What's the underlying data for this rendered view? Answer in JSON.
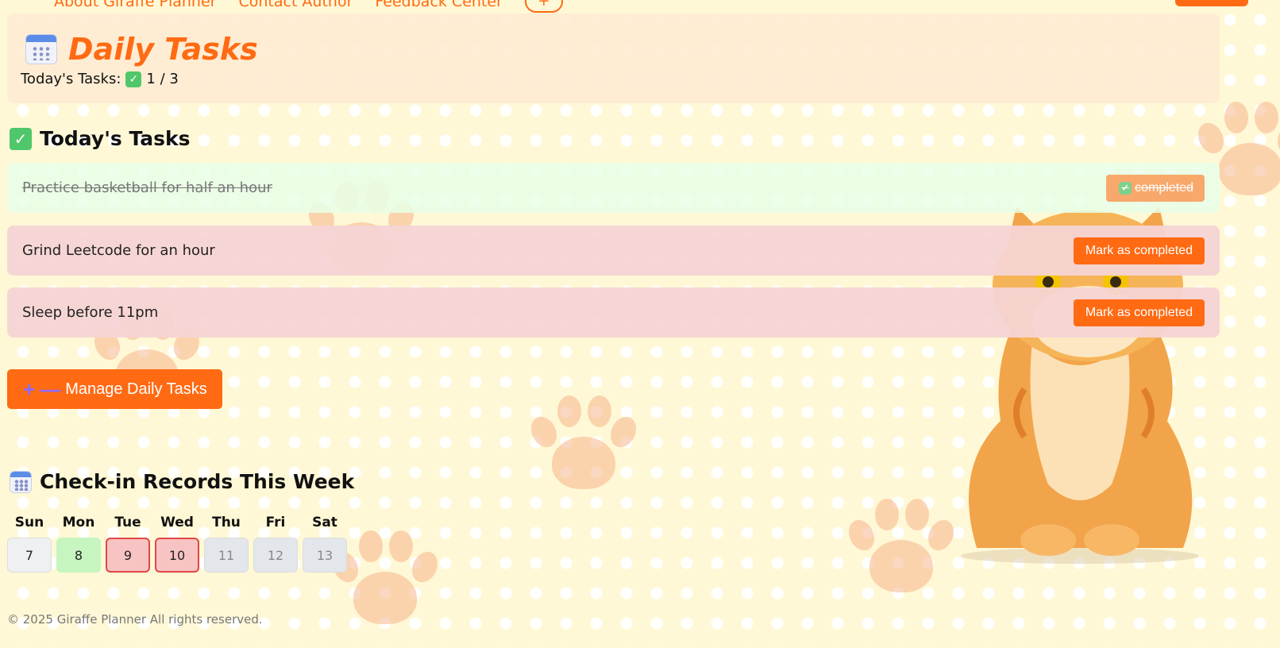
{
  "nav": {
    "links": [
      "About Giraffe Planner",
      "Contact Author",
      "Feedback Center"
    ],
    "plus_label": "+"
  },
  "header": {
    "icon": "calendar-icon",
    "title": "Daily Tasks",
    "progress_label": "Today's Tasks:",
    "progress_value": "1 / 3"
  },
  "tasks_section": {
    "icon": "check-mark-icon",
    "title": "Today's Tasks",
    "items": [
      {
        "text": "Practice basketball for half an hour",
        "status": "completed",
        "button_label": "completed"
      },
      {
        "text": "Grind Leetcode for an hour",
        "status": "pending",
        "button_label": "Mark as completed"
      },
      {
        "text": "Sleep before 11pm",
        "status": "pending",
        "button_label": "Mark as completed"
      }
    ],
    "manage_button": {
      "plus": "+",
      "minus": "—",
      "label": "Manage Daily Tasks"
    }
  },
  "checkin": {
    "icon": "calendar-icon",
    "title": "Check-in Records This Week",
    "days": [
      {
        "label": "Sun",
        "date": "7",
        "state": "none"
      },
      {
        "label": "Mon",
        "date": "8",
        "state": "checked"
      },
      {
        "label": "Tue",
        "date": "9",
        "state": "missed"
      },
      {
        "label": "Wed",
        "date": "10",
        "state": "missed"
      },
      {
        "label": "Thu",
        "date": "11",
        "state": "future"
      },
      {
        "label": "Fri",
        "date": "12",
        "state": "future"
      },
      {
        "label": "Sat",
        "date": "13",
        "state": "future"
      }
    ]
  },
  "footer": {
    "text": "© 2025 Giraffe Planner All rights reserved."
  },
  "colors": {
    "accent": "#ff6a13",
    "completed_row": "#e8ffe8",
    "pending_row": "#f6d4d4",
    "checked_day": "#c6f5bf",
    "missed_day": "#f8c3c3"
  }
}
